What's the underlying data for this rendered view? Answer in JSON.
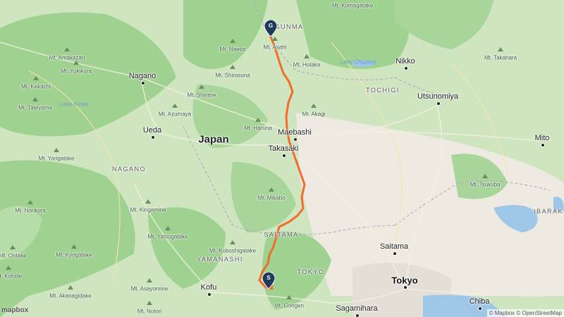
{
  "map": {
    "countries": [
      {
        "name": "Japan"
      }
    ],
    "regions": [
      {
        "name": "GUNMA"
      },
      {
        "name": "TOCHIGI"
      },
      {
        "name": "NAGANO"
      },
      {
        "name": "SAITAMA"
      },
      {
        "name": "YAMANASHI"
      },
      {
        "name": "TOKYO"
      },
      {
        "name": "IBARAKI"
      }
    ],
    "cities": [
      {
        "name": "Nagano"
      },
      {
        "name": "Ueda"
      },
      {
        "name": "Maebashi"
      },
      {
        "name": "Takasaki"
      },
      {
        "name": "Nikko"
      },
      {
        "name": "Utsunomiya"
      },
      {
        "name": "Mito"
      },
      {
        "name": "Saitama"
      },
      {
        "name": "Tokyo"
      },
      {
        "name": "Sagamihara"
      },
      {
        "name": "Chiba"
      },
      {
        "name": "Kofu"
      }
    ],
    "peaks": [
      {
        "name": "Mt. Komagatake"
      },
      {
        "name": "Mt. Amakazari"
      },
      {
        "name": "Mt. Yukikura"
      },
      {
        "name": "Mt. Kekachi"
      },
      {
        "name": "Mt. Tateyama"
      },
      {
        "name": "Mt. Naeba"
      },
      {
        "name": "Mt. Asahi"
      },
      {
        "name": "Mt. Hotaka"
      },
      {
        "name": "Mt. Takahara"
      },
      {
        "name": "Mt. Shirasuna"
      },
      {
        "name": "Mt. Shirane"
      },
      {
        "name": "Mt. Azumaya"
      },
      {
        "name": "Mt. Akagi"
      },
      {
        "name": "Mt. Haruna"
      },
      {
        "name": "Mt. Yarigatake"
      },
      {
        "name": "Mt. Norikura"
      },
      {
        "name": "Mt. Kirigamine"
      },
      {
        "name": "Mt. Mikabo"
      },
      {
        "name": "Mt. Yatsugatake"
      },
      {
        "name": "Mt. Ontake"
      },
      {
        "name": "Mt. Kyogatake"
      },
      {
        "name": "Mt. Kobushigatake"
      },
      {
        "name": "Mt. Asayomine"
      },
      {
        "name": "Mt. Akanagidake"
      },
      {
        "name": "Mt. Kohide"
      },
      {
        "name": "Mt. Notori"
      },
      {
        "name": "Mt. Gongen"
      },
      {
        "name": "Mt. Tsukuba"
      }
    ],
    "water": [
      {
        "name": "Lake Kizaki"
      },
      {
        "name": "Lake Chuzenji"
      }
    ],
    "markers": {
      "start": {
        "label": "S"
      },
      "goal": {
        "label": "G"
      }
    },
    "colors": {
      "forest": "#9fd190",
      "route": "#f26c2a",
      "urban": "#eeeae2",
      "water": "#9ec6e6",
      "marker": "#1f3a5a"
    },
    "logo": "mapbox",
    "attribution": "© Mapbox © OpenStreetMap"
  }
}
